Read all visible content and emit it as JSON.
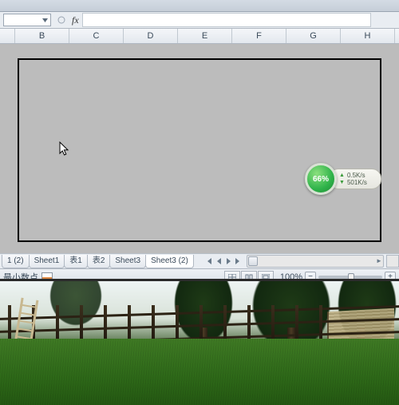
{
  "formula_bar": {
    "namebox_value": "",
    "fx_label": "fx",
    "formula_value": ""
  },
  "columns": [
    "B",
    "C",
    "D",
    "E",
    "F",
    "G",
    "H"
  ],
  "sheet_tabs": [
    {
      "label": "1 (2)",
      "active": false
    },
    {
      "label": "Sheet1",
      "active": false
    },
    {
      "label": "表1",
      "active": false
    },
    {
      "label": "表2",
      "active": false
    },
    {
      "label": "Sheet3",
      "active": false
    },
    {
      "label": "Sheet3 (2)",
      "active": true
    }
  ],
  "status": {
    "left_label": "最小数点",
    "zoom": "100%"
  },
  "speed_widget": {
    "percent": "66%",
    "up": "0.5K/s",
    "down": "501K/s"
  }
}
